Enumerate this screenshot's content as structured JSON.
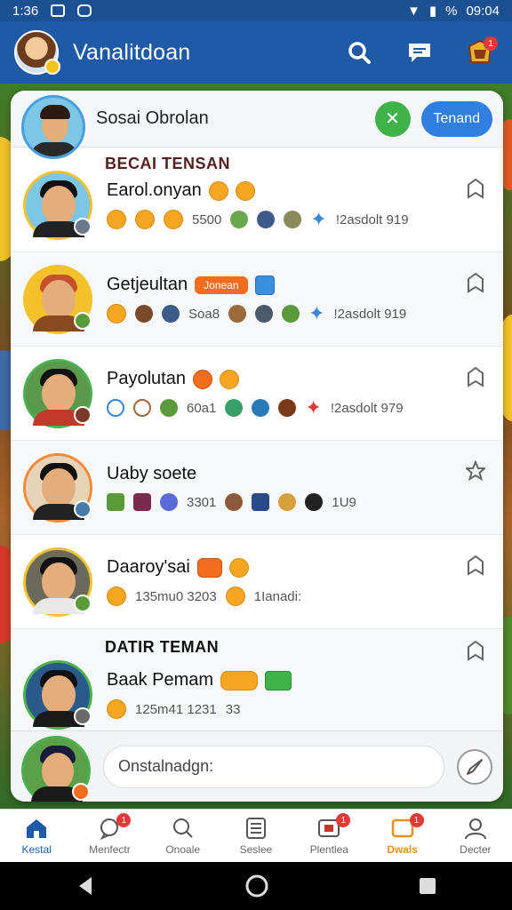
{
  "status_bar": {
    "time_left": "1:36",
    "battery": "%",
    "time_right": "09:04"
  },
  "header": {
    "title": "Vanalitdoan",
    "search_icon": "search-icon",
    "chat_icon": "chat-bubble-icon",
    "notification_badge": "1"
  },
  "card": {
    "title": "Sosai Obrolan",
    "green_button_symbol": "✕",
    "teman_button": "Tenand",
    "section1_label": "BECAI TENSAN",
    "section2_label": "DATIR TEMAN"
  },
  "rows": [
    {
      "name": "Earol.onyan",
      "tag": "",
      "meta_a": "5500",
      "meta_b": "!2asdolt 919"
    },
    {
      "name": "Getjeultan",
      "tag": "Jonean",
      "meta_a": "Soa8",
      "meta_b": "!2asdolt 919"
    },
    {
      "name": "Payolutan",
      "tag": "",
      "meta_a": "60a1",
      "meta_b": "!2asdolt 979"
    },
    {
      "name": "Uaby soete",
      "tag": "",
      "meta_a": "3301",
      "meta_b": "1U9"
    },
    {
      "name": "Daaroy'sai",
      "tag": "",
      "meta_a": "135mu0 3203",
      "meta_b": "1Ianadi:"
    },
    {
      "name": "Baak Pemam",
      "tag": "",
      "meta_a": "125m41 1231",
      "meta_b": "33"
    }
  ],
  "input": {
    "placeholder": "Onstalnadgn:"
  },
  "bottom_nav": [
    {
      "label": "Kestal",
      "badge": ""
    },
    {
      "label": "Menfectr",
      "badge": "1"
    },
    {
      "label": "Onoale",
      "badge": ""
    },
    {
      "label": "Seslee",
      "badge": ""
    },
    {
      "label": "Plentlea",
      "badge": "1"
    },
    {
      "label": "Dwals",
      "badge": "1"
    },
    {
      "label": "Decter",
      "badge": ""
    }
  ],
  "colors": {
    "header_blue": "#1f5aa6",
    "accent_blue": "#2f7ee0",
    "green": "#3fb34a",
    "orange": "#f26d1d"
  }
}
